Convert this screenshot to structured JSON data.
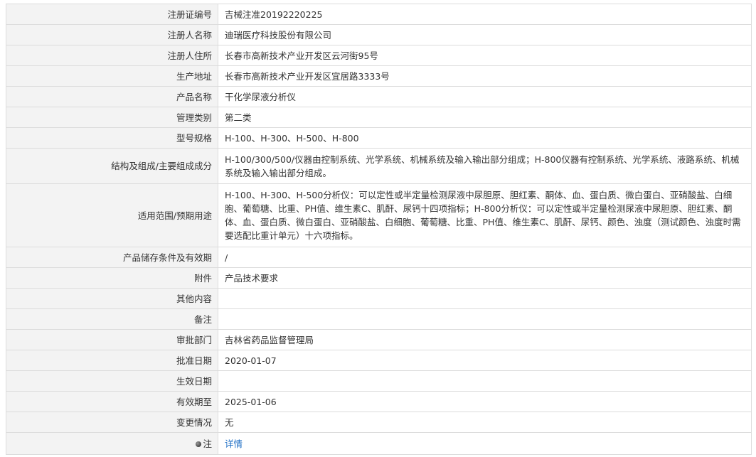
{
  "rows": [
    {
      "label": "注册证编号",
      "value": "吉械注准20192220225",
      "size": "single"
    },
    {
      "label": "注册人名称",
      "value": "迪瑞医疗科技股份有限公司",
      "size": "single"
    },
    {
      "label": "注册人住所",
      "value": "长春市高新技术产业开发区云河街95号",
      "size": "single"
    },
    {
      "label": "生产地址",
      "value": "长春市高新技术产业开发区宜居路3333号",
      "size": "single"
    },
    {
      "label": "产品名称",
      "value": "干化学尿液分析仪",
      "size": "single"
    },
    {
      "label": "管理类别",
      "value": "第二类",
      "size": "single"
    },
    {
      "label": "型号规格",
      "value": "H-100、H-300、H-500、H-800",
      "size": "single"
    },
    {
      "label": "结构及组成/主要组成成分",
      "value": "H-100/300/500/仪器由控制系统、光学系统、机械系统及输入输出部分组成；H-800仪器有控制系统、光学系统、液路系统、机械系统及输入输出部分组成。",
      "size": "double"
    },
    {
      "label": "适用范围/预期用途",
      "value": "H-100、H-300、H-500分析仪：可以定性或半定量检测尿液中尿胆原、胆红素、酮体、血、蛋白质、微白蛋白、亚硝酸盐、白细胞、葡萄糖、比重、PH值、维生素C、肌酐、尿钙十四项指标；H-800分析仪：可以定性或半定量检测尿液中尿胆原、胆红素、酮体、血、蛋白质、微白蛋白、亚硝酸盐、白细胞、葡萄糖、比重、PH值、维生素C、肌酐、尿钙、颜色、浊度（测试颜色、浊度时需要选配比重计单元）十六项指标。",
      "size": "quad"
    },
    {
      "label": "产品储存条件及有效期",
      "value": "/",
      "size": "single"
    },
    {
      "label": "附件",
      "value": "产品技术要求",
      "size": "single"
    },
    {
      "label": "其他内容",
      "value": "",
      "size": "single"
    },
    {
      "label": "备注",
      "value": "",
      "size": "single"
    },
    {
      "label": "审批部门",
      "value": "吉林省药品监督管理局",
      "size": "single"
    },
    {
      "label": "批准日期",
      "value": "2020-01-07",
      "size": "single"
    },
    {
      "label": "生效日期",
      "value": "",
      "size": "single"
    },
    {
      "label": "有效期至",
      "value": "2025-01-06",
      "size": "single"
    },
    {
      "label": "变更情况",
      "value": "无",
      "size": "single"
    }
  ],
  "note": {
    "label": "注",
    "icon": "bullet-icon",
    "link_text": "详情"
  },
  "colors": {
    "label_bg": "#f3f3f3",
    "border": "#dcdcdc",
    "text": "#333333",
    "link": "#1f6fc5"
  }
}
